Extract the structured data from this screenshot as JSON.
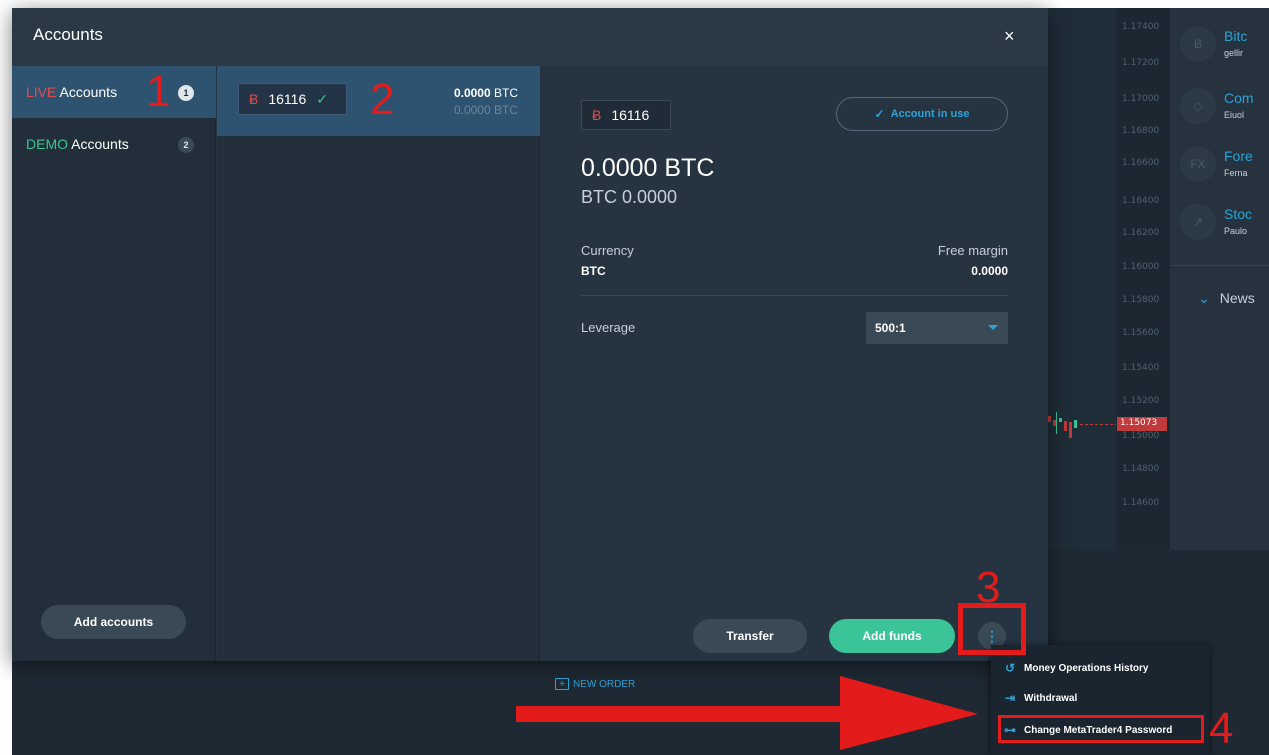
{
  "modal": {
    "title": "Accounts",
    "close_icon": "×"
  },
  "account_types": [
    {
      "prefix": "LIVE",
      "label": " Accounts",
      "count": "1"
    },
    {
      "prefix": "DEMO",
      "label": " Accounts",
      "count": "2"
    }
  ],
  "add_accounts_label": "Add accounts",
  "account_row": {
    "currency_icon": "Ƀ",
    "number": "16116",
    "balance_value": "0.0000",
    "balance_currency": " BTC",
    "secondary_balance": "0.0000 BTC"
  },
  "detail": {
    "currency_icon": "Ƀ",
    "number": "16116",
    "in_use_label": "Account in use",
    "big_balance": "0.0000 BTC",
    "sub_balance": "BTC 0.0000",
    "currency_label": "Currency",
    "currency_value": "BTC",
    "free_margin_label": "Free margin",
    "free_margin_value": "0.0000",
    "leverage_label": "Leverage",
    "leverage_value": "500:1",
    "transfer_label": "Transfer",
    "add_funds_label": "Add funds",
    "more_icon": "⋮"
  },
  "menu": {
    "items": [
      {
        "icon": "↺",
        "label": "Money Operations History"
      },
      {
        "icon": "⇥",
        "label": "Withdrawal"
      },
      {
        "icon": "⊶",
        "label": "Change MetaTrader4 Password"
      }
    ]
  },
  "chart": {
    "ticks": [
      "1.17400",
      "1.17200",
      "1.17000",
      "1.16800",
      "1.16600",
      "1.16400",
      "1.16200",
      "1.16000",
      "1.15800",
      "1.15600",
      "1.15400",
      "1.15200",
      "1.15000",
      "1.14800",
      "1.14600"
    ],
    "current_price": "1.15073"
  },
  "right_panel": {
    "items": [
      {
        "icon": "Ƀ",
        "title": "Bitc",
        "sub": "gellir"
      },
      {
        "icon": "◇",
        "title": "Com",
        "sub": "Eiuol"
      },
      {
        "icon": "FX",
        "title": "Fore",
        "sub": "Ferna"
      },
      {
        "icon": "↗",
        "title": "Stoc",
        "sub": "Paulo"
      }
    ],
    "news_label": "News",
    "news_icon": "⌄"
  },
  "new_order_label": "NEW ORDER",
  "new_order_icon": "+",
  "annotations": [
    "1",
    "2",
    "3",
    "4"
  ],
  "colors": {
    "live": "#e14c4c",
    "demo": "#3bc497",
    "accent": "#2aa3d9",
    "annotation": "#e31b1b"
  }
}
